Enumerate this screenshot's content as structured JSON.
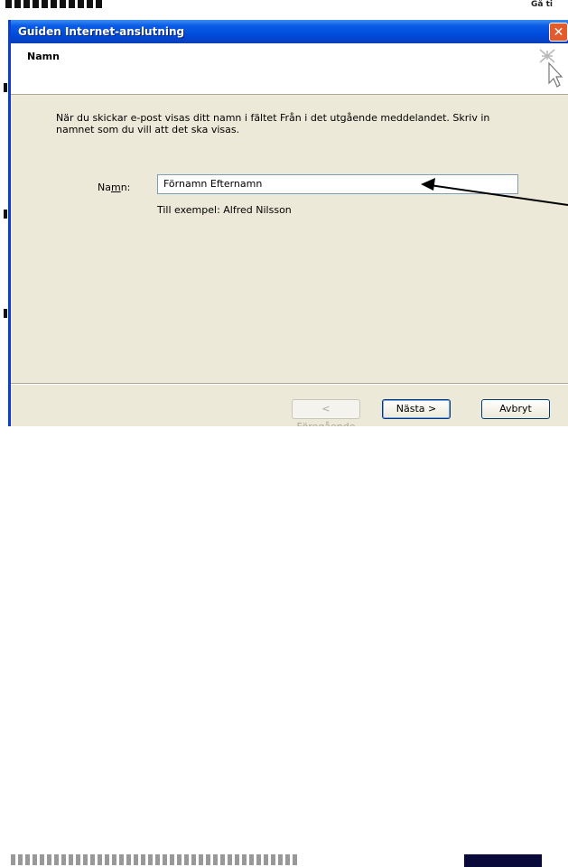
{
  "window": {
    "title": "Guiden Internet-anslutning",
    "close_symbol": "✕"
  },
  "header": {
    "title": "Namn"
  },
  "main": {
    "instructions": "När du skickar e-post visas ditt namn i fältet Från i det utgående meddelandet. Skriv in namnet som du vill att det ska visas.",
    "name_label": "Namn:",
    "name_value": "Förnamn Efternamn",
    "example": "Till exempel: Alfred Nilsson"
  },
  "buttons": {
    "back": "< Föregående",
    "next": "Nästa >",
    "cancel": "Avbryt"
  },
  "background": {
    "top_right_text": "Gå ti"
  }
}
